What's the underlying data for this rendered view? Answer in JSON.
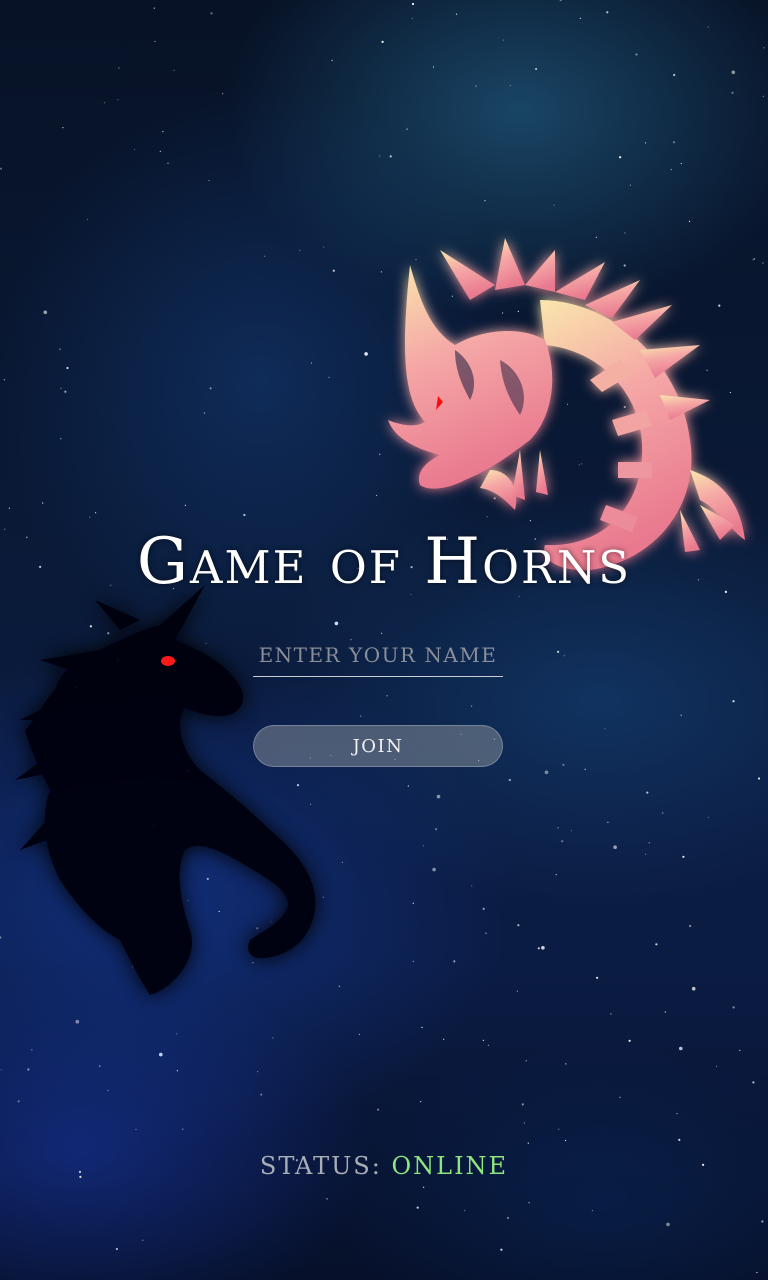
{
  "app": {
    "title": "Game of Horns"
  },
  "login": {
    "name_placeholder": "ENTER YOUR NAME",
    "name_value": "",
    "join_label": "JOIN"
  },
  "status": {
    "label": "STATUS: ",
    "value": "ONLINE",
    "value_color": "#8fe57e"
  },
  "art": {
    "dragon": "dragon-emblem",
    "unicorn": "unicorn-silhouette",
    "dragon_color_top": "#f7e1a6",
    "dragon_color_bottom": "#ee7f96",
    "unicorn_eye_color": "#ff1a1a"
  },
  "background": {
    "theme": "starfield-nebula"
  }
}
